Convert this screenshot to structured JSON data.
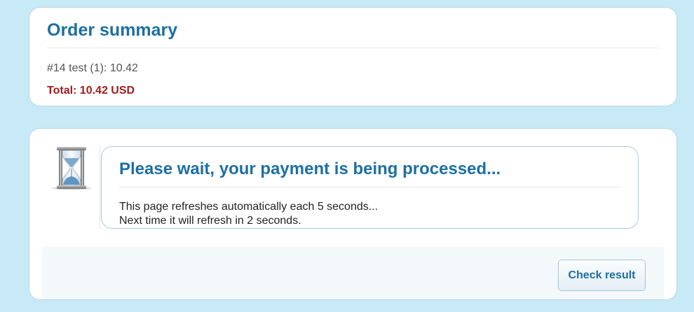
{
  "summary": {
    "title": "Order summary",
    "line_item": "#14 test (1): 10.42",
    "total": "Total: 10.42 USD"
  },
  "payment": {
    "icon": "hourglass-icon",
    "title": "Please wait, your payment is being processed...",
    "line1": "This page refreshes automatically each 5 seconds...",
    "line2": "Next time it will refresh in 2 seconds.",
    "check_button": "Check result"
  },
  "colors": {
    "background": "#c8eaf7",
    "heading": "#1d6fa3",
    "total": "#a01c1c"
  }
}
